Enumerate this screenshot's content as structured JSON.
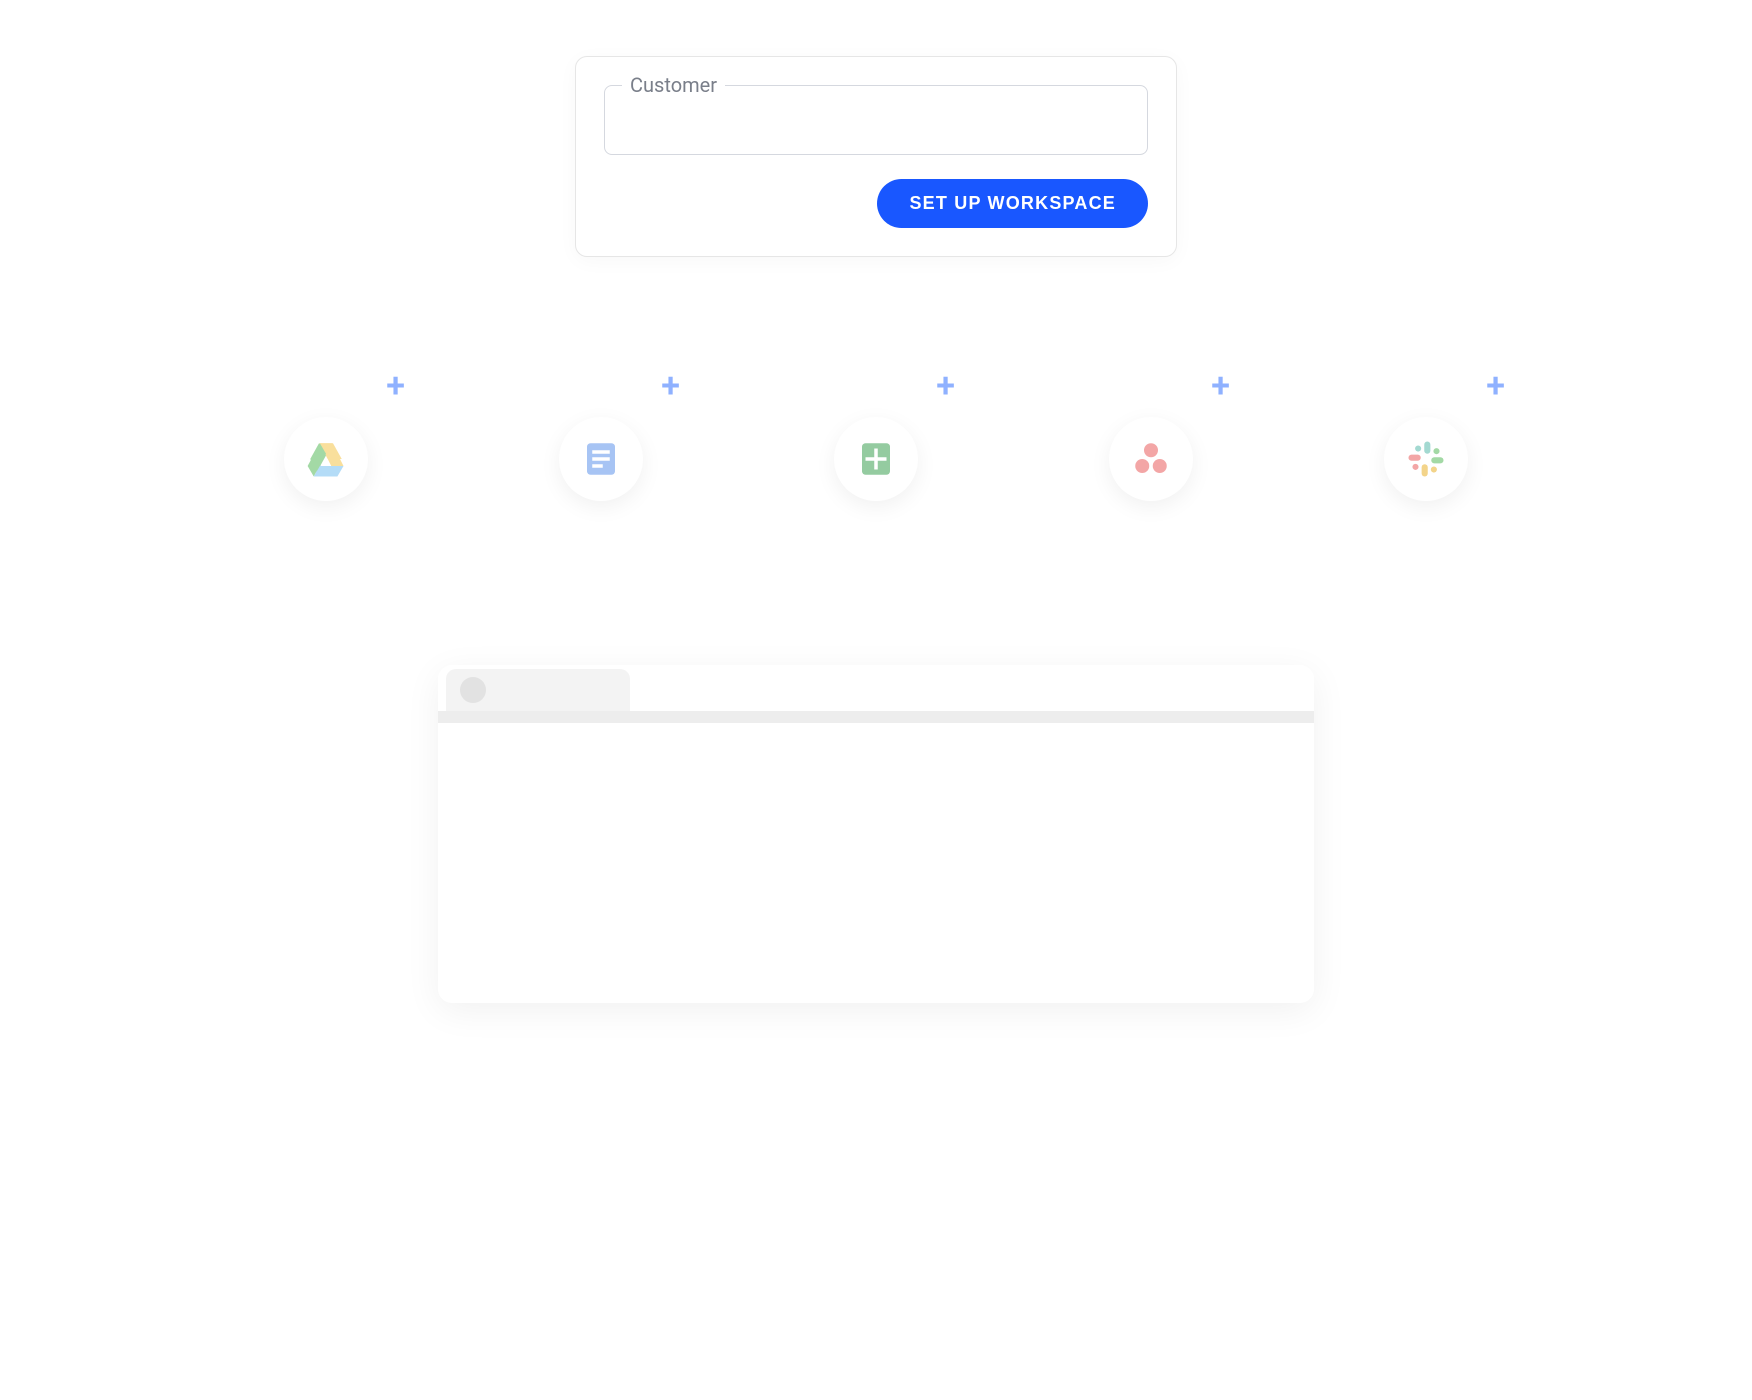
{
  "form": {
    "field_label": "Customer",
    "field_value": "",
    "submit_label": "SET UP WORKSPACE"
  },
  "integrations": [
    {
      "name": "google-drive"
    },
    {
      "name": "google-docs"
    },
    {
      "name": "google-sheets"
    },
    {
      "name": "asana"
    },
    {
      "name": "slack"
    }
  ],
  "plus_glyph": "+"
}
